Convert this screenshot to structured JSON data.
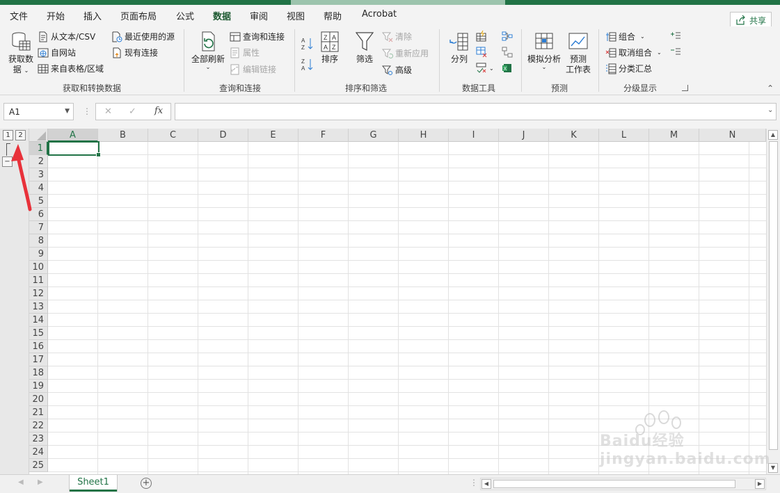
{
  "menu": {
    "tabs": [
      "文件",
      "开始",
      "插入",
      "页面布局",
      "公式",
      "数据",
      "审阅",
      "视图",
      "帮助",
      "Acrobat"
    ],
    "active_tab": "数据",
    "share_label": "共享"
  },
  "ribbon": {
    "get_data": {
      "big_label_line1": "获取数",
      "big_label_line2": "据",
      "from_text_csv": "从文本/CSV",
      "from_web": "自网站",
      "from_table": "来自表格/区域",
      "recent_sources": "最近使用的源",
      "existing_connections": "现有连接",
      "group_label": "获取和转换数据"
    },
    "queries": {
      "refresh_all": "全部刷新",
      "queries_connections": "查询和连接",
      "properties": "属性",
      "edit_links": "编辑链接",
      "group_label": "查询和连接"
    },
    "sort_filter": {
      "sort": "排序",
      "filter": "筛选",
      "clear": "清除",
      "reapply": "重新应用",
      "advanced": "高级",
      "group_label": "排序和筛选"
    },
    "data_tools": {
      "text_to_columns": "分列",
      "group_label": "数据工具"
    },
    "forecast": {
      "what_if": "模拟分析",
      "forecast_sheet_line1": "预测",
      "forecast_sheet_line2": "工作表",
      "group_label": "预测"
    },
    "outline": {
      "group": "组合",
      "ungroup": "取消组合",
      "subtotal": "分类汇总",
      "group_label": "分级显示"
    }
  },
  "formula_bar": {
    "name_box": "A1",
    "fx_label": "fx",
    "formula_value": ""
  },
  "grid": {
    "columns": [
      "A",
      "B",
      "C",
      "D",
      "E",
      "F",
      "G",
      "H",
      "I",
      "J",
      "K",
      "L",
      "M",
      "N"
    ],
    "rows": [
      "1",
      "2",
      "3",
      "4",
      "5",
      "6",
      "7",
      "8",
      "9",
      "10",
      "11",
      "12",
      "13",
      "14",
      "15",
      "16",
      "17",
      "18",
      "19",
      "20",
      "21",
      "22",
      "23",
      "24",
      "25"
    ],
    "outline_levels": [
      "1",
      "2"
    ],
    "collapse_symbol": "−"
  },
  "sheets": {
    "tabs": [
      "Sheet1"
    ],
    "active": "Sheet1"
  },
  "colors": {
    "accent": "#217346",
    "arrow": "#e8313a"
  },
  "watermark_text": "Baidu经验 jingyan.baidu.com"
}
